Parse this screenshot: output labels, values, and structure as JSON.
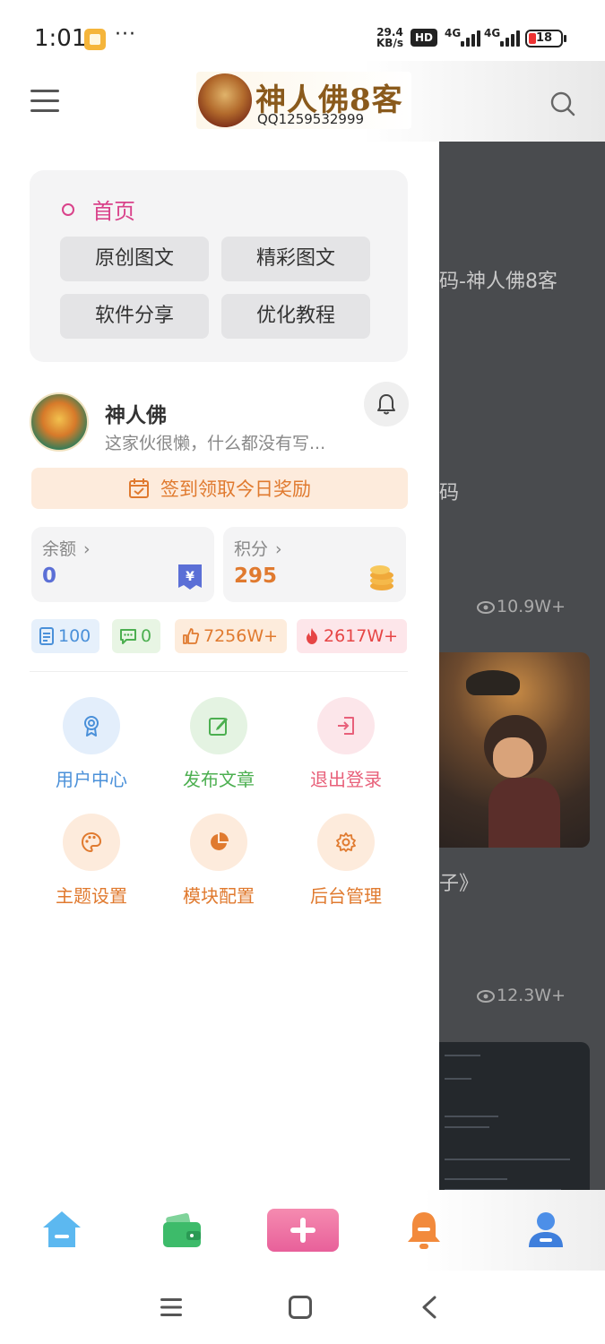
{
  "status_bar": {
    "time": "1:01",
    "more": "···",
    "speed_value": "29.4",
    "speed_unit": "KB/s",
    "hd": "HD",
    "net1": "4G",
    "net2": "4G",
    "battery": "18"
  },
  "header": {
    "logo_text": "神人佛8客",
    "logo_qq": "QQ1259532999"
  },
  "background_page": {
    "text1": "码-神人佛8客",
    "text2": "码",
    "views1": "10.9W+",
    "text3": "子》",
    "views2": "12.3W+"
  },
  "drawer": {
    "nav": {
      "home": "首页",
      "items": [
        "原创图文",
        "精彩图文",
        "软件分享",
        "优化教程"
      ]
    },
    "profile": {
      "name": "神人佛",
      "bio": "这家伙很懒，什么都没有写..."
    },
    "checkin": "签到领取今日奖励",
    "stats": {
      "balance_label": "余额",
      "balance_value": "0",
      "points_label": "积分",
      "points_value": "295"
    },
    "chips": {
      "posts": "100",
      "comments": "0",
      "likes": "7256W+",
      "hot": "2617W+"
    },
    "actions": [
      "用户中心",
      "发布文章",
      "退出登录",
      "主题设置",
      "模块配置",
      "后台管理"
    ]
  },
  "colors": {
    "accent_pink": "#d9428a",
    "orange": "#e07a2f",
    "blue": "#4a90d9",
    "green": "#4caf50",
    "red": "#e64545"
  }
}
